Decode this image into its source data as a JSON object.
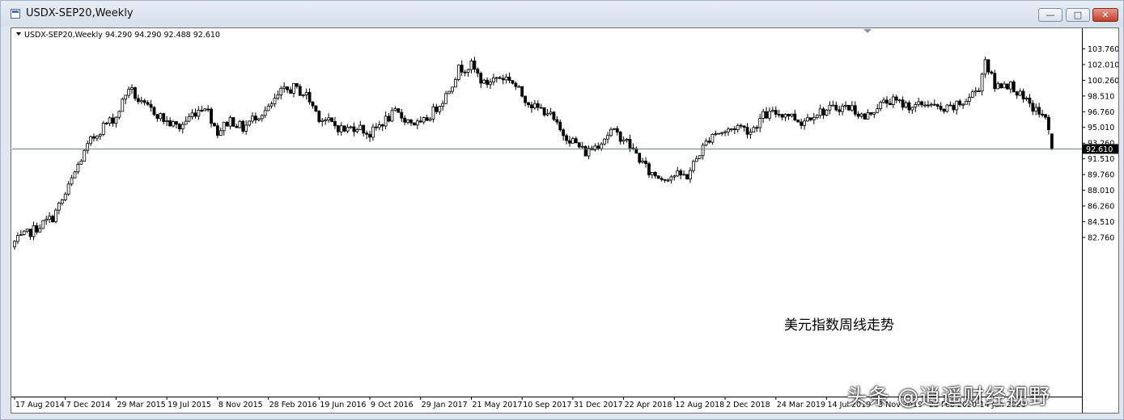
{
  "window": {
    "title": "USDX-SEP20,Weekly",
    "min_glyph": "—",
    "max_glyph": "□",
    "close_glyph": "✕"
  },
  "chart_header": "USDX-SEP20,Weekly  94.290 94.290 92.488 92.610",
  "annotation": "美元指数周线走势",
  "watermark": "头条 @逍遥财经视野",
  "colors": {
    "bullish": "#ffffff",
    "bearish": "#000000",
    "price_line": "#5f7f7f",
    "price_tag_bg": "#000000",
    "price_tag_text": "#ffffff"
  },
  "chart_data": {
    "type": "candlestick",
    "title": "USDX-SEP20,Weekly",
    "current_price": 92.61,
    "ohlc_last": {
      "open": 94.29,
      "high": 94.29,
      "low": 92.488,
      "close": 92.61
    },
    "ylim": [
      81.0,
      104.85
    ],
    "y_ticks": [
      "103.760",
      "102.010",
      "100.260",
      "98.510",
      "96.760",
      "95.010",
      "93.260",
      "91.510",
      "89.760",
      "88.010",
      "86.260",
      "84.510",
      "82.760"
    ],
    "x_ticks": [
      "17 Aug 2014",
      "7 Dec 2014",
      "29 Mar 2015",
      "19 Jul 2015",
      "8 Nov 2015",
      "28 Feb 2016",
      "19 Jun 2016",
      "9 Oct 2016",
      "29 Jan 2017",
      "21 May 2017",
      "10 Sep 2017",
      "31 Dec 2017",
      "22 Apr 2018",
      "12 Aug 2018",
      "2 Dec 2018",
      "24 Mar 2019",
      "14 Jul 2019",
      "3 Nov 2019",
      "23 Feb 2020",
      "14 Jun 2020"
    ],
    "weeks_per_tick": 16,
    "anchors": [
      [
        0,
        82.2
      ],
      [
        12,
        85.0
      ],
      [
        16,
        87.5
      ],
      [
        20,
        90.8
      ],
      [
        24,
        93.5
      ],
      [
        28,
        95.2
      ],
      [
        32,
        96.2
      ],
      [
        36,
        99.5
      ],
      [
        40,
        97.5
      ],
      [
        44,
        96.8
      ],
      [
        48,
        95.6
      ],
      [
        52,
        95.0
      ],
      [
        56,
        96.5
      ],
      [
        60,
        97.5
      ],
      [
        64,
        94.5
      ],
      [
        68,
        95.9
      ],
      [
        72,
        94.9
      ],
      [
        76,
        96.3
      ],
      [
        80,
        97.0
      ],
      [
        84,
        98.9
      ],
      [
        88,
        99.4
      ],
      [
        92,
        98.6
      ],
      [
        96,
        96.2
      ],
      [
        100,
        95.4
      ],
      [
        104,
        94.7
      ],
      [
        108,
        95.2
      ],
      [
        112,
        94.2
      ],
      [
        116,
        95.6
      ],
      [
        120,
        96.6
      ],
      [
        124,
        95.8
      ],
      [
        128,
        95.2
      ],
      [
        132,
        96.8
      ],
      [
        136,
        98.6
      ],
      [
        140,
        101.5
      ],
      [
        144,
        101.9
      ],
      [
        148,
        99.8
      ],
      [
        152,
        100.6
      ],
      [
        156,
        100.5
      ],
      [
        160,
        98.6
      ],
      [
        164,
        97.2
      ],
      [
        168,
        96.8
      ],
      [
        172,
        94.6
      ],
      [
        176,
        93.5
      ],
      [
        180,
        92.2
      ],
      [
        184,
        93.2
      ],
      [
        188,
        94.6
      ],
      [
        192,
        93.8
      ],
      [
        196,
        92.0
      ],
      [
        200,
        90.0
      ],
      [
        204,
        89.4
      ],
      [
        208,
        89.7
      ],
      [
        212,
        89.6
      ],
      [
        216,
        92.2
      ],
      [
        220,
        94.4
      ],
      [
        224,
        94.5
      ],
      [
        228,
        95.2
      ],
      [
        232,
        94.6
      ],
      [
        236,
        96.3
      ],
      [
        240,
        96.6
      ],
      [
        244,
        96.5
      ],
      [
        248,
        95.6
      ],
      [
        252,
        96.6
      ],
      [
        256,
        96.9
      ],
      [
        260,
        97.3
      ],
      [
        264,
        97.2
      ],
      [
        268,
        96.0
      ],
      [
        272,
        97.4
      ],
      [
        276,
        98.0
      ],
      [
        280,
        97.6
      ],
      [
        284,
        97.3
      ],
      [
        288,
        97.8
      ],
      [
        292,
        96.8
      ],
      [
        296,
        97.2
      ],
      [
        300,
        98.0
      ],
      [
        304,
        99.5
      ],
      [
        306,
        102.6
      ],
      [
        309,
        99.5
      ],
      [
        312,
        100.0
      ],
      [
        315,
        99.5
      ],
      [
        318,
        98.0
      ],
      [
        321,
        97.2
      ],
      [
        324,
        96.3
      ],
      [
        326,
        95.2
      ],
      [
        327,
        92.61
      ]
    ]
  }
}
